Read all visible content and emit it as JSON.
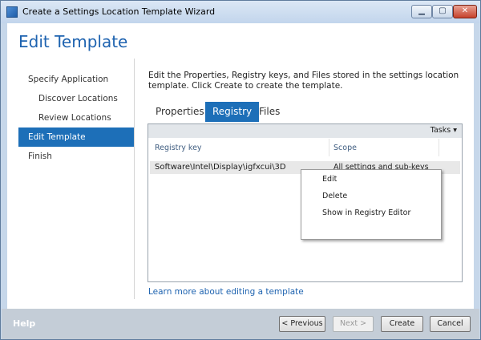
{
  "window": {
    "title": "Create a Settings Location Template Wizard"
  },
  "page_title": "Edit Template",
  "nav": [
    {
      "label": "Specify Application"
    },
    {
      "label": "Discover Locations"
    },
    {
      "label": "Review Locations"
    },
    {
      "label": "Edit Template"
    },
    {
      "label": "Finish"
    }
  ],
  "description": "Edit the Properties, Registry keys, and Files stored in the settings location template. Click Create to create the template.",
  "tabs": [
    {
      "label": "Properties"
    },
    {
      "label": "Registry"
    },
    {
      "label": "Files"
    }
  ],
  "tasks_label": "Tasks ▾",
  "columns": {
    "key": "Registry key",
    "scope": "Scope"
  },
  "rows": [
    {
      "key": "Software\\Intel\\Display\\igfxcui\\3D",
      "scope": "All settings and sub-keys"
    }
  ],
  "context_menu": [
    {
      "label": "Edit"
    },
    {
      "label": "Delete"
    },
    {
      "label": "Show in Registry Editor"
    }
  ],
  "learn_more": "Learn more about editing a template",
  "footer": {
    "help": "Help",
    "previous": "< Previous",
    "next": "Next >",
    "create": "Create",
    "cancel": "Cancel"
  },
  "colors": {
    "accent": "#1d6fb8",
    "title_blue": "#1e63b0"
  }
}
